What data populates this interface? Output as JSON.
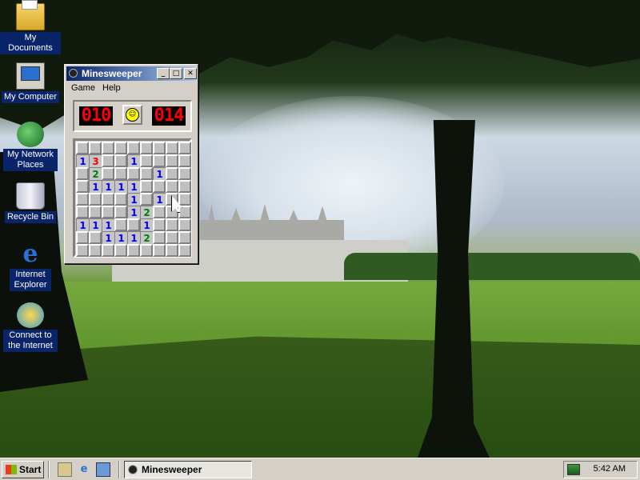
{
  "desktop": {
    "icons": [
      {
        "label": "My Documents",
        "icon": "my-documents-icon"
      },
      {
        "label": "My Computer",
        "icon": "my-computer-icon"
      },
      {
        "label": "My Network Places",
        "icon": "network-places-icon"
      },
      {
        "label": "Recycle Bin",
        "icon": "recycle-bin-icon"
      },
      {
        "label": "Internet Explorer",
        "icon": "internet-explorer-icon"
      },
      {
        "label": "Connect to the Internet",
        "icon": "connect-internet-icon"
      }
    ]
  },
  "window": {
    "title": "Minesweeper",
    "controls": {
      "minimize": "_",
      "maximize": "□",
      "close": "✕"
    },
    "menu": [
      "Game",
      "Help"
    ],
    "mine_counter": "010",
    "timer": "014",
    "smiley": "☺",
    "grid": {
      "rows": 9,
      "cols": 9,
      "cells": [
        [
          "c",
          "c",
          "c",
          "c",
          "c",
          "c",
          "c",
          "c",
          "c"
        ],
        [
          "1",
          "3",
          "c",
          "c",
          "1",
          "c",
          "c",
          "c",
          "c"
        ],
        [
          "c",
          "2",
          "c",
          "c",
          "c",
          "c",
          "1",
          "c",
          "c"
        ],
        [
          "c",
          "1",
          "1",
          "1",
          "1",
          "c",
          "c",
          "c",
          "c"
        ],
        [
          "c",
          "c",
          "c",
          "c",
          "1",
          "c",
          "1",
          "c",
          "c"
        ],
        [
          "c",
          "c",
          "c",
          "c",
          "1",
          "2",
          "c",
          "c",
          "c"
        ],
        [
          "1",
          "1",
          "1",
          "c",
          "c",
          "1",
          "c",
          "c",
          "c"
        ],
        [
          "c",
          "c",
          "1",
          "1",
          "1",
          "2",
          "c",
          "c",
          "c"
        ],
        [
          "c",
          "c",
          "c",
          "c",
          "c",
          "c",
          "c",
          "c",
          "c"
        ]
      ]
    },
    "number_colors": {
      "1": "#0000ff",
      "2": "#008000",
      "3": "#ff0000"
    }
  },
  "taskbar": {
    "start_label": "Start",
    "quick_launch": [
      "desktop-icon",
      "internet-explorer-icon",
      "outlook-icon"
    ],
    "task_button_label": "Minesweeper",
    "clock": "5:42 AM"
  }
}
